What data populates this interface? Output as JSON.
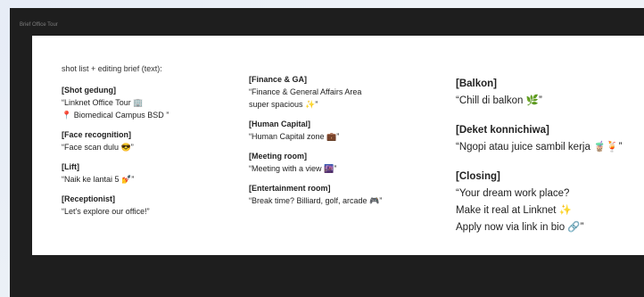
{
  "window": {
    "title": "Brief Office Tour"
  },
  "col1": {
    "intro": "shot list + editing brief (text):",
    "blocks": [
      {
        "heading": "[Shot gedung]",
        "lines": [
          "“Linknet Office Tour 🏢",
          "📍 Biomedical Campus BSD ”"
        ]
      },
      {
        "heading": "[Face recognition]",
        "lines": [
          "“Face scan dulu 😎”"
        ]
      },
      {
        "heading": "[Lift]",
        "lines": [
          "“Naik ke lantai 5 💅”"
        ]
      },
      {
        "heading": "[Receptionist]",
        "lines": [
          "“Let's explore our office!”"
        ]
      }
    ]
  },
  "col2": {
    "blocks": [
      {
        "heading": "[Finance & GA]",
        "lines": [
          "“Finance & General Affairs Area",
          "super spacious ✨”"
        ]
      },
      {
        "heading": "[Human Capital]",
        "lines": [
          "“Human Capital zone 💼”"
        ]
      },
      {
        "heading": "[Meeting room]",
        "lines": [
          "“Meeting with a view 🌆”"
        ]
      },
      {
        "heading": "[Entertainment room]",
        "lines": [
          "“Break time? Billiard, golf, arcade 🎮”"
        ]
      }
    ]
  },
  "col3": {
    "blocks": [
      {
        "heading": "[Balkon]",
        "lines": [
          "“Chill di balkon 🌿”"
        ]
      },
      {
        "heading": "[Deket konnichiwa]",
        "lines": [
          "“Ngopi atau juice sambil kerja 🧋🍹”"
        ]
      },
      {
        "heading": "[Closing]",
        "lines": [
          "“Your dream work place?",
          "Make it real at Linknet ✨",
          "Apply now via link in bio 🔗”"
        ]
      }
    ]
  }
}
